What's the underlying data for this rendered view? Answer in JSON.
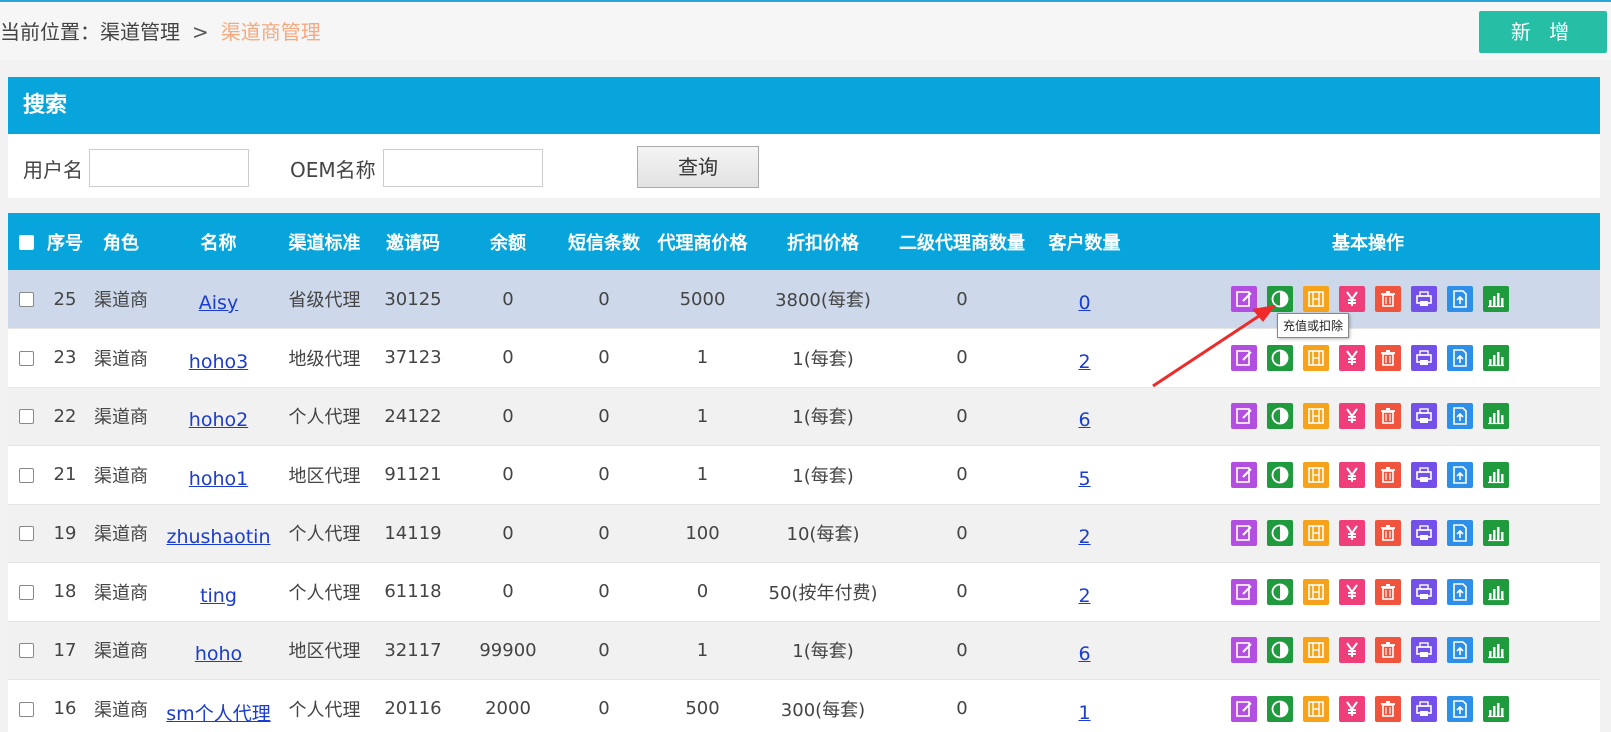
{
  "breadcrumb": {
    "prefix": "当前位置：渠道管理",
    "separator": ">",
    "current": "渠道商管理"
  },
  "add_button": "新 增",
  "search": {
    "title": "搜索",
    "username_label": "用户名",
    "username_value": "",
    "oem_label": "OEM名称",
    "oem_value": "",
    "query_button": "查询"
  },
  "table": {
    "headers": [
      "序号",
      "角色",
      "名称",
      "渠道标准",
      "邀请码",
      "余额",
      "短信条数",
      "代理商价格",
      "折扣价格",
      "二级代理商数量",
      "客户数量",
      "基本操作"
    ],
    "rows": [
      {
        "id": "25",
        "role": "渠道商",
        "name": "Aisy",
        "level": "省级代理",
        "code": "30125",
        "balance": "0",
        "sms": "0",
        "agent_price": "5000",
        "discount": "3800(每套)",
        "sub_agents": "0",
        "customers": "0"
      },
      {
        "id": "23",
        "role": "渠道商",
        "name": "hoho3",
        "level": "地级代理",
        "code": "37123",
        "balance": "0",
        "sms": "0",
        "agent_price": "1",
        "discount": "1(每套)",
        "sub_agents": "0",
        "customers": "2"
      },
      {
        "id": "22",
        "role": "渠道商",
        "name": "hoho2",
        "level": "个人代理",
        "code": "24122",
        "balance": "0",
        "sms": "0",
        "agent_price": "1",
        "discount": "1(每套)",
        "sub_agents": "0",
        "customers": "6"
      },
      {
        "id": "21",
        "role": "渠道商",
        "name": "hoho1",
        "level": "地区代理",
        "code": "91121",
        "balance": "0",
        "sms": "0",
        "agent_price": "1",
        "discount": "1(每套)",
        "sub_agents": "0",
        "customers": "5"
      },
      {
        "id": "19",
        "role": "渠道商",
        "name": "zhushaotin",
        "level": "个人代理",
        "code": "14119",
        "balance": "0",
        "sms": "0",
        "agent_price": "100",
        "discount": "10(每套)",
        "sub_agents": "0",
        "customers": "2"
      },
      {
        "id": "18",
        "role": "渠道商",
        "name": "ting",
        "level": "个人代理",
        "code": "61118",
        "balance": "0",
        "sms": "0",
        "agent_price": "0",
        "discount": "50(按年付费)",
        "sub_agents": "0",
        "customers": "2"
      },
      {
        "id": "17",
        "role": "渠道商",
        "name": "hoho",
        "level": "地区代理",
        "code": "32117",
        "balance": "99900",
        "sms": "0",
        "agent_price": "1",
        "discount": "1(每套)",
        "sub_agents": "0",
        "customers": "6"
      },
      {
        "id": "16",
        "role": "渠道商",
        "name": "sm个人代理",
        "level": "个人代理",
        "code": "20116",
        "balance": "2000",
        "sms": "0",
        "agent_price": "500",
        "discount": "300(每套)",
        "sub_agents": "0",
        "customers": "1"
      }
    ]
  },
  "ops": [
    {
      "icon": "edit-icon",
      "color": "#b24fe0"
    },
    {
      "icon": "contrast-icon",
      "color": "#1f9a3c"
    },
    {
      "icon": "recharge-icon",
      "color": "#f7a21b"
    },
    {
      "icon": "yen-icon",
      "color": "#ef3f7b"
    },
    {
      "icon": "trash-icon",
      "color": "#f0543c"
    },
    {
      "icon": "printer-icon",
      "color": "#7350e8"
    },
    {
      "icon": "document-icon",
      "color": "#2d8fe8"
    },
    {
      "icon": "bar-chart-icon",
      "color": "#1f9a3c"
    }
  ],
  "tooltip": "充值或扣除",
  "arrow_color": "#ee2a2a"
}
